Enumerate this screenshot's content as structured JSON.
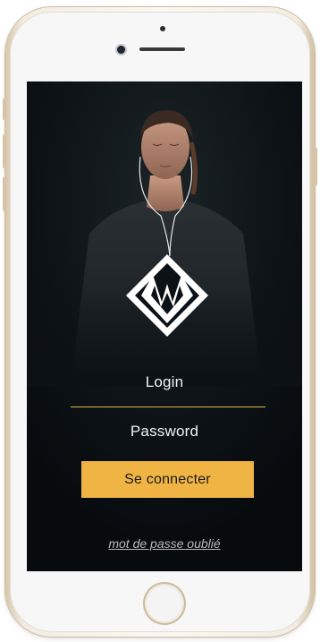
{
  "form": {
    "login_placeholder": "Login",
    "password_placeholder": "Password",
    "submit_label": "Se connecter",
    "forgot_password_link": "mot de passe oublié"
  },
  "colors": {
    "accent": "#f0b444",
    "screen_background": "#0c1116",
    "text": "#f2f2f2",
    "link": "#b9b9b9"
  },
  "icons": {
    "logo": "diamond-logo-icon"
  }
}
